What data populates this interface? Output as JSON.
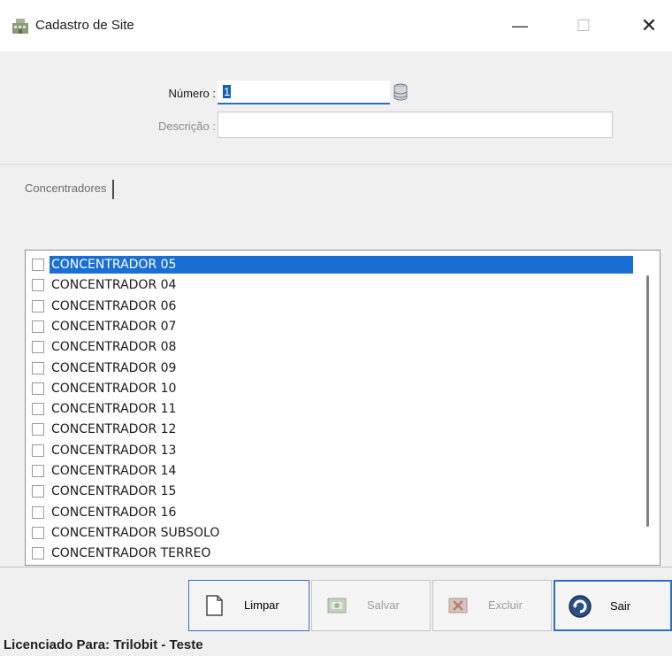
{
  "window": {
    "title": "Cadastro de Site",
    "minimize_glyph": "—",
    "maximize_glyph": "☐",
    "close_glyph": "✕",
    "icon": "building-icon"
  },
  "form": {
    "numero_label": "Número :",
    "numero_value": "1",
    "descricao_label": "Descrição :",
    "descricao_value": "",
    "lookup_icon": "database-icon"
  },
  "tabs": [
    {
      "label": "Concentradores"
    }
  ],
  "list": {
    "selected_index": 0,
    "items": [
      {
        "label": "CONCENTRADOR 05",
        "checked": false
      },
      {
        "label": "CONCENTRADOR 04",
        "checked": false
      },
      {
        "label": "CONCENTRADOR 06",
        "checked": false
      },
      {
        "label": "CONCENTRADOR 07",
        "checked": false
      },
      {
        "label": "CONCENTRADOR 08",
        "checked": false
      },
      {
        "label": "CONCENTRADOR 09",
        "checked": false
      },
      {
        "label": "CONCENTRADOR 10",
        "checked": false
      },
      {
        "label": "CONCENTRADOR 11",
        "checked": false
      },
      {
        "label": "CONCENTRADOR 12",
        "checked": false
      },
      {
        "label": "CONCENTRADOR 13",
        "checked": false
      },
      {
        "label": "CONCENTRADOR 14",
        "checked": false
      },
      {
        "label": "CONCENTRADOR 15",
        "checked": false
      },
      {
        "label": "CONCENTRADOR 16",
        "checked": false
      },
      {
        "label": "CONCENTRADOR SUBSOLO",
        "checked": false
      },
      {
        "label": "CONCENTRADOR TERREO",
        "checked": false
      }
    ]
  },
  "buttons": {
    "limpar": {
      "label": "Limpar",
      "icon": "document-icon",
      "enabled": true
    },
    "salvar": {
      "label": "Salvar",
      "icon": "save-icon",
      "enabled": false
    },
    "excluir": {
      "label": "Excluir",
      "icon": "delete-icon",
      "enabled": false
    },
    "sair": {
      "label": "Sair",
      "icon": "exit-globe-icon",
      "enabled": true
    }
  },
  "status": {
    "text": "Licenciado Para: Trilobit - Teste"
  },
  "colors": {
    "selection": "#1a6fd4",
    "focus_border": "#2b6fc7",
    "background": "#f0f0f0"
  }
}
